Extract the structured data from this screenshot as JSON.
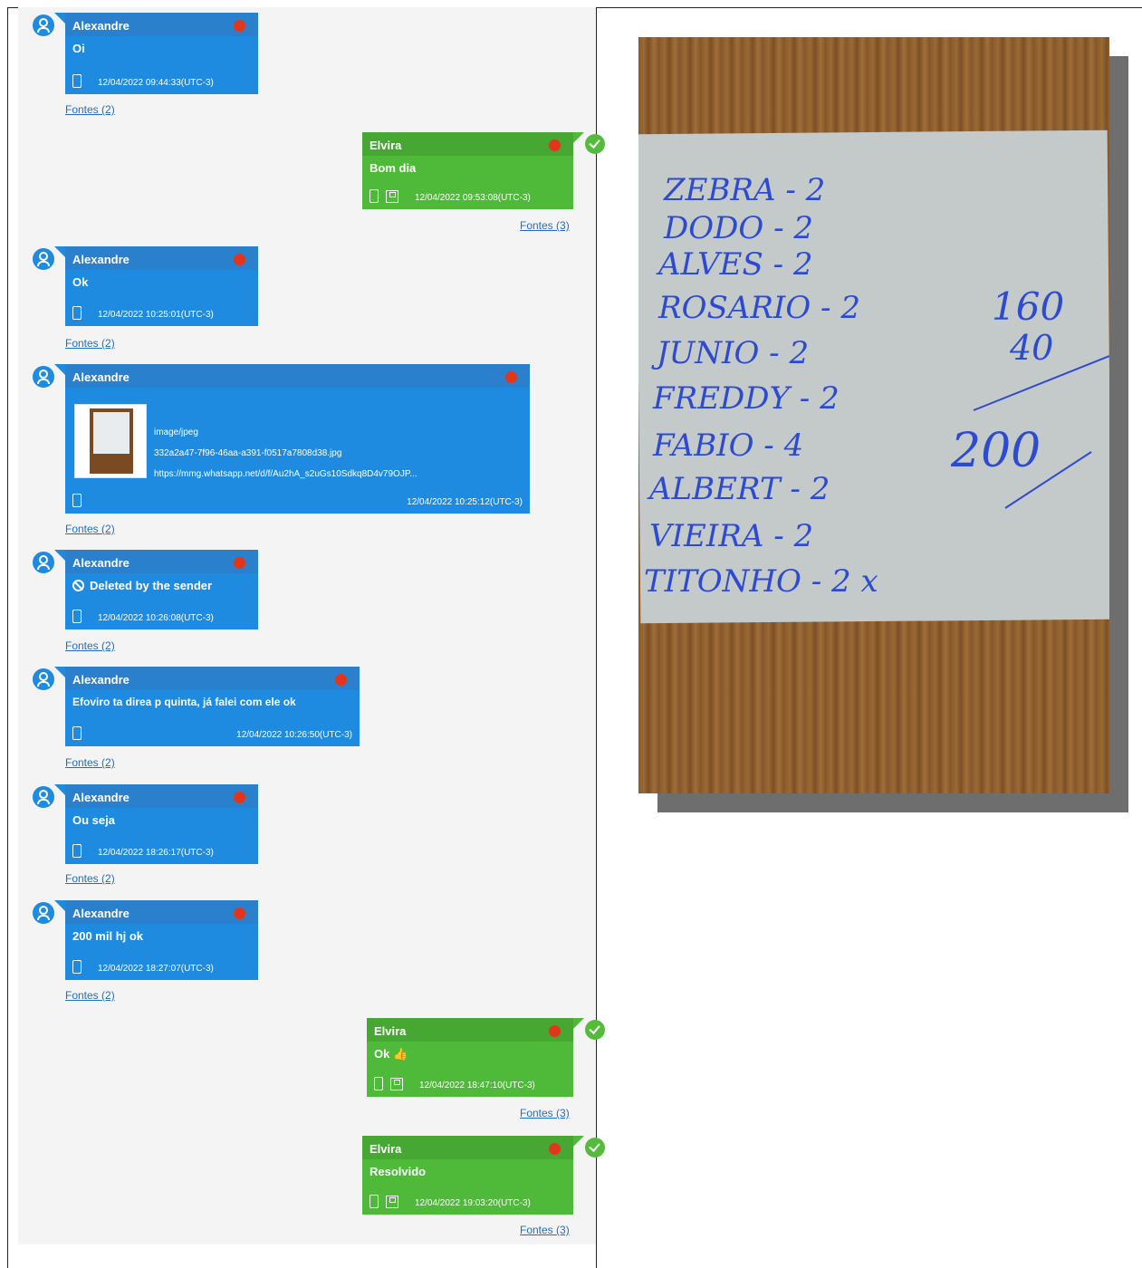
{
  "messages": [
    {
      "side": "in",
      "sender": "Alexandre",
      "text": "Oi",
      "time": "12/04/2022 09:44:33(UTC-3)",
      "sources": "Fontes (2)"
    },
    {
      "side": "out",
      "sender": "Elvira",
      "text": "Bom dia",
      "time": "12/04/2022 09:53:08(UTC-3)",
      "sources": "Fontes (3)"
    },
    {
      "side": "in",
      "sender": "Alexandre",
      "text": "Ok",
      "time": "12/04/2022 10:25:01(UTC-3)",
      "sources": "Fontes (2)"
    },
    {
      "side": "in",
      "sender": "Alexandre",
      "attachment": {
        "mime": "image/jpeg",
        "file": "332a2a47-7f96-46aa-a391-f0517a7808d38.jpg",
        "url": "https://mmg.whatsapp.net/d/f/Au2hA_s2uGs10Sdkq8D4v79OJP..."
      },
      "time": "12/04/2022 10:25:12(UTC-3)",
      "sources": "Fontes (2)"
    },
    {
      "side": "in",
      "sender": "Alexandre",
      "text": "Deleted by the sender",
      "time": "12/04/2022 10:26:08(UTC-3)",
      "sources": "Fontes (2)"
    },
    {
      "side": "in",
      "sender": "Alexandre",
      "text": "Efoviro ta direa p quinta, já falei com ele ok",
      "time": "12/04/2022 10:26:50(UTC-3)",
      "sources": "Fontes (2)"
    },
    {
      "side": "in",
      "sender": "Alexandre",
      "text": "Ou seja",
      "time": "12/04/2022 18:26:17(UTC-3)",
      "sources": "Fontes (2)"
    },
    {
      "side": "in",
      "sender": "Alexandre",
      "text": "200 mil hj ok",
      "time": "12/04/2022 18:27:07(UTC-3)",
      "sources": "Fontes (2)"
    },
    {
      "side": "out",
      "sender": "Elvira",
      "text": "Ok 👍",
      "time": "12/04/2022 18:47:10(UTC-3)",
      "sources": "Fontes (3)"
    },
    {
      "side": "out",
      "sender": "Elvira",
      "text": "Resolvido",
      "time": "12/04/2022 19:03:20(UTC-3)",
      "sources": "Fontes (3)"
    }
  ],
  "note": {
    "lines": [
      "ZEBRA - 2",
      "DODO - 2",
      "ALVES - 2",
      "ROSARIO - 2",
      "JUNIO - 2",
      "FREDDY - 2",
      "FABIO - 4",
      "ALBERT - 2",
      "VIEIRA - 2",
      "TITONHO - 2 x"
    ],
    "side_values": [
      "160",
      "40",
      "200"
    ]
  },
  "colors": {
    "incoming": "#1f8be0",
    "outgoing": "#4fba3a",
    "dot": "#e0361c",
    "ink": "#2d4bd0"
  }
}
